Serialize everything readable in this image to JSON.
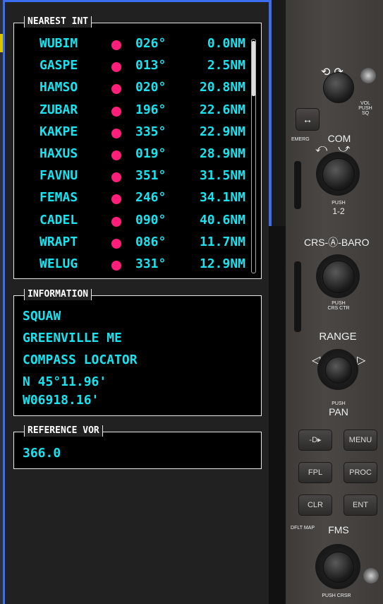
{
  "nearest": {
    "title": "NEAREST INT",
    "rows": [
      {
        "id": "WUBIM",
        "brg": "026°",
        "dist": "0.0NM"
      },
      {
        "id": "GASPE",
        "brg": "013°",
        "dist": "2.5NM"
      },
      {
        "id": "HAMSO",
        "brg": "020°",
        "dist": "20.8NM"
      },
      {
        "id": "ZUBAR",
        "brg": "196°",
        "dist": "22.6NM"
      },
      {
        "id": "KAKPE",
        "brg": "335°",
        "dist": "22.9NM"
      },
      {
        "id": "HAXUS",
        "brg": "019°",
        "dist": "28.9NM"
      },
      {
        "id": "FAVNU",
        "brg": "351°",
        "dist": "31.5NM"
      },
      {
        "id": "FEMAS",
        "brg": "246°",
        "dist": "34.1NM"
      },
      {
        "id": "CADEL",
        "brg": "090°",
        "dist": "40.6NM"
      },
      {
        "id": "WRAPT",
        "brg": "086°",
        "dist": "11.7NM"
      },
      {
        "id": "WELUG",
        "brg": "331°",
        "dist": "12.9NM"
      }
    ]
  },
  "information": {
    "title": "INFORMATION",
    "name": "SQUAW",
    "city": "GREENVILLE ME",
    "type": "COMPASS LOCATOR",
    "lat": "N 45°11.96'",
    "lon": "W06918.16'"
  },
  "reference_vor": {
    "title": "REFERENCE VOR",
    "value": "366.0"
  },
  "controls": {
    "vol_label": "VOL PUSH SQ",
    "emerg_label": "EMERG",
    "com_label": "COM",
    "push12_label": "PUSH",
    "push12_value": "1-2",
    "crs_baro_label": "CRS-Ⓐ-BARO",
    "crs_push_label": "PUSH",
    "crs_ctr_label": "CRS CTR",
    "range_label": "RANGE",
    "pan_push_label": "PUSH",
    "pan_label": "PAN",
    "direct_to": "-D▸",
    "menu": "MENU",
    "fpl": "FPL",
    "proc": "PROC",
    "clr": "CLR",
    "ent": "ENT",
    "dflt_map": "DFLT MAP",
    "fms_label": "FMS",
    "push_crsr": "PUSH CRSR"
  },
  "colors": {
    "accent_cyan": "#18e3f0",
    "waypoint_magenta": "#ff1f7a",
    "frame_blue": "#3a6df0"
  }
}
